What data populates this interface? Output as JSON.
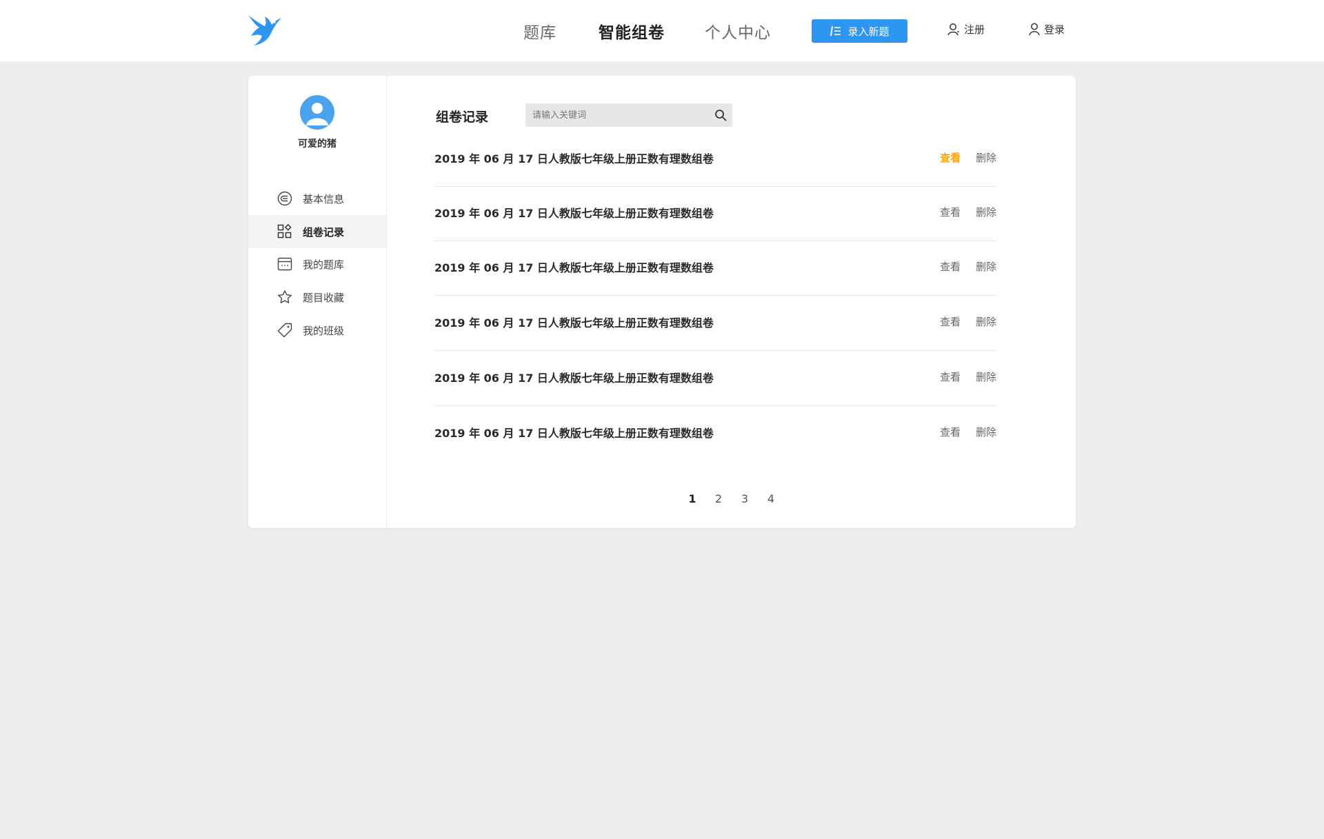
{
  "header": {
    "nav": [
      {
        "label": "题库",
        "active": false
      },
      {
        "label": "智能组卷",
        "active": true
      },
      {
        "label": "个人中心",
        "active": false
      }
    ],
    "new_button_label": "录入新题",
    "register_label": "注册",
    "login_label": "登录",
    "colors": {
      "accent": "#2d96f2",
      "logo": "#2d96f2"
    }
  },
  "sidebar": {
    "username": "可爱的猪",
    "items": [
      {
        "label": "基本信息",
        "icon": "info-circle-icon",
        "active": false
      },
      {
        "label": "组卷记录",
        "icon": "grid-icon",
        "active": true
      },
      {
        "label": "我的题库",
        "icon": "calendar-icon",
        "active": false
      },
      {
        "label": "题目收藏",
        "icon": "star-icon",
        "active": false
      },
      {
        "label": "我的班级",
        "icon": "tag-icon",
        "active": false
      }
    ]
  },
  "main": {
    "title": "组卷记录",
    "search": {
      "placeholder": "请输入关键词",
      "value": ""
    },
    "view_label": "查看",
    "delete_label": "删除",
    "records": [
      {
        "title": "2019 年 06 月 17 日人教版七年级上册正数有理数组卷",
        "view_highlighted": true
      },
      {
        "title": "2019 年 06 月 17 日人教版七年级上册正数有理数组卷",
        "view_highlighted": false
      },
      {
        "title": "2019 年 06 月 17 日人教版七年级上册正数有理数组卷",
        "view_highlighted": false
      },
      {
        "title": "2019 年 06 月 17 日人教版七年级上册正数有理数组卷",
        "view_highlighted": false
      },
      {
        "title": "2019 年 06 月 17 日人教版七年级上册正数有理数组卷",
        "view_highlighted": false
      },
      {
        "title": "2019 年 06 月 17 日人教版七年级上册正数有理数组卷",
        "view_highlighted": false
      }
    ],
    "pagination": {
      "pages": [
        "1",
        "2",
        "3",
        "4"
      ],
      "current": "1"
    }
  }
}
